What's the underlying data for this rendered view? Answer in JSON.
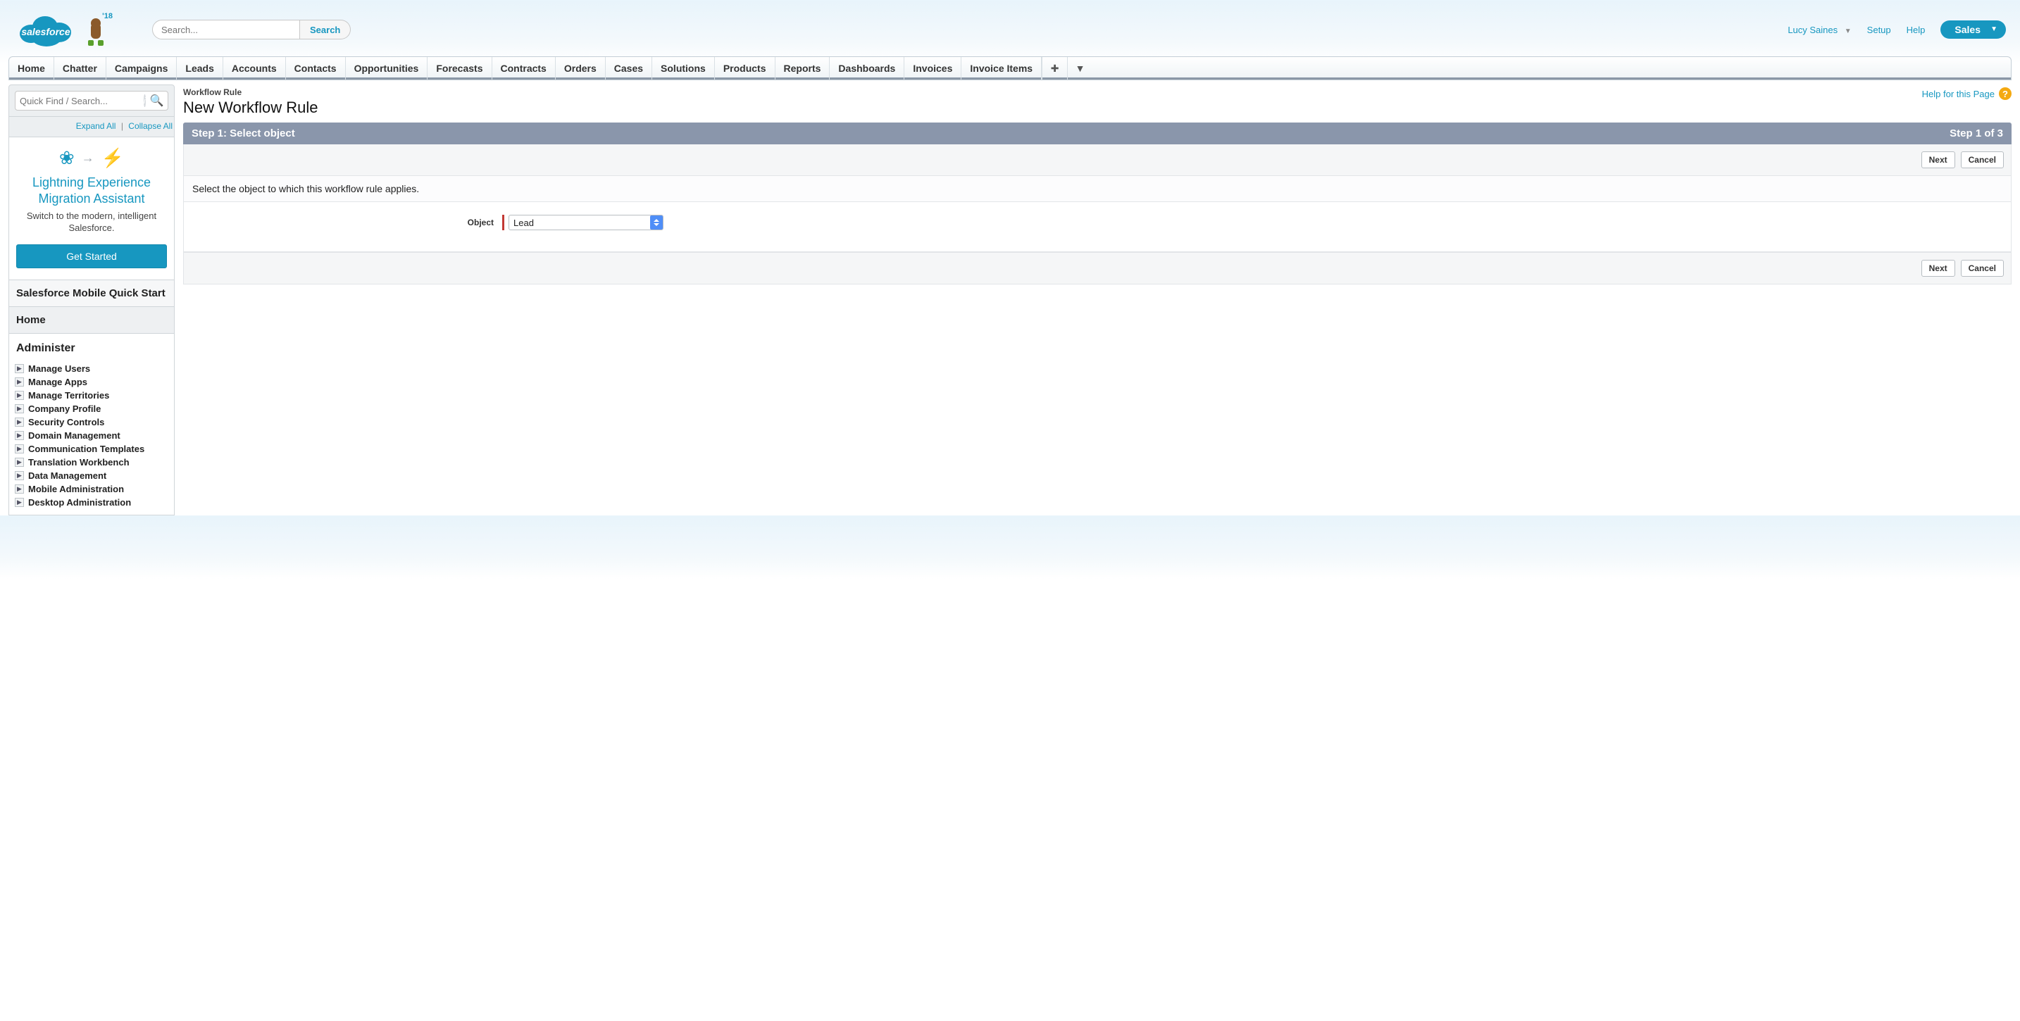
{
  "header": {
    "logo_text": "salesforce",
    "year_badge": "'18",
    "search_placeholder": "Search...",
    "search_button": "Search",
    "username": "Lucy Saines",
    "setup": "Setup",
    "help": "Help",
    "app_name": "Sales"
  },
  "tabs": [
    "Home",
    "Chatter",
    "Campaigns",
    "Leads",
    "Accounts",
    "Contacts",
    "Opportunities",
    "Forecasts",
    "Contracts",
    "Orders",
    "Cases",
    "Solutions",
    "Products",
    "Reports",
    "Dashboards",
    "Invoices",
    "Invoice Items"
  ],
  "sidebar": {
    "quickfind_placeholder": "Quick Find / Search...",
    "expand_all": "Expand All",
    "collapse_all": "Collapse All",
    "lex": {
      "title": "Lightning Experience Migration Assistant",
      "subtitle": "Switch to the modern, intelligent Salesforce.",
      "button": "Get Started"
    },
    "mobile_quick_start": "Salesforce Mobile Quick Start",
    "home": "Home",
    "administer_heading": "Administer",
    "admin_items": [
      "Manage Users",
      "Manage Apps",
      "Manage Territories",
      "Company Profile",
      "Security Controls",
      "Domain Management",
      "Communication Templates",
      "Translation Workbench",
      "Data Management",
      "Mobile Administration",
      "Desktop Administration"
    ]
  },
  "main": {
    "eyebrow": "Workflow Rule",
    "title": "New Workflow Rule",
    "help_link": "Help for this Page",
    "step_title": "Step 1: Select object",
    "step_progress": "Step 1 of 3",
    "instruction": "Select the object to which this workflow rule applies.",
    "object_label": "Object",
    "object_selected": "Lead",
    "next": "Next",
    "cancel": "Cancel"
  }
}
